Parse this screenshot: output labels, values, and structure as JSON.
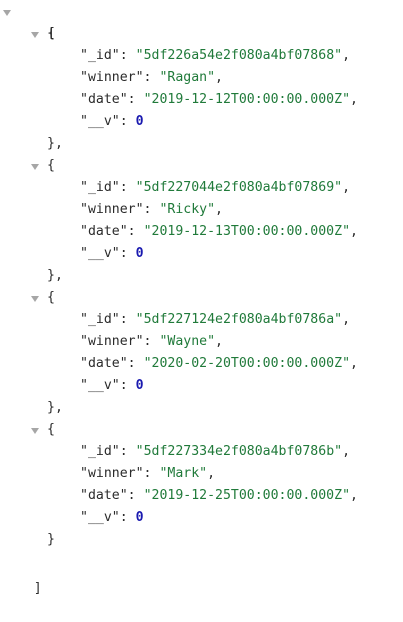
{
  "viewer": {
    "open_array": "[",
    "close_array": "]",
    "open_object": "{",
    "close_object_comma": "},",
    "close_object": "}",
    "quote": "\"",
    "colon": ": ",
    "comma": ","
  },
  "records": [
    {
      "_id": "5df226a54e2f080a4bf07868",
      "winner": "Ragan",
      "date": "2019-12-12T00:00:00.000Z",
      "__v": "0"
    },
    {
      "_id": "5df227044e2f080a4bf07869",
      "winner": "Ricky",
      "date": "2019-12-13T00:00:00.000Z",
      "__v": "0"
    },
    {
      "_id": "5df227124e2f080a4bf0786a",
      "winner": "Wayne",
      "date": "2020-02-20T00:00:00.000Z",
      "__v": "0"
    },
    {
      "_id": "5df227334e2f080a4bf0786b",
      "winner": "Mark",
      "date": "2019-12-25T00:00:00.000Z",
      "__v": "0"
    }
  ],
  "keys": {
    "id": "_id",
    "winner": "winner",
    "date": "date",
    "v": "__v"
  },
  "colors": {
    "string": "#207a3a",
    "number": "#1a1ab0",
    "toggle": "#a6a6a6",
    "text": "#2b2b2b"
  }
}
